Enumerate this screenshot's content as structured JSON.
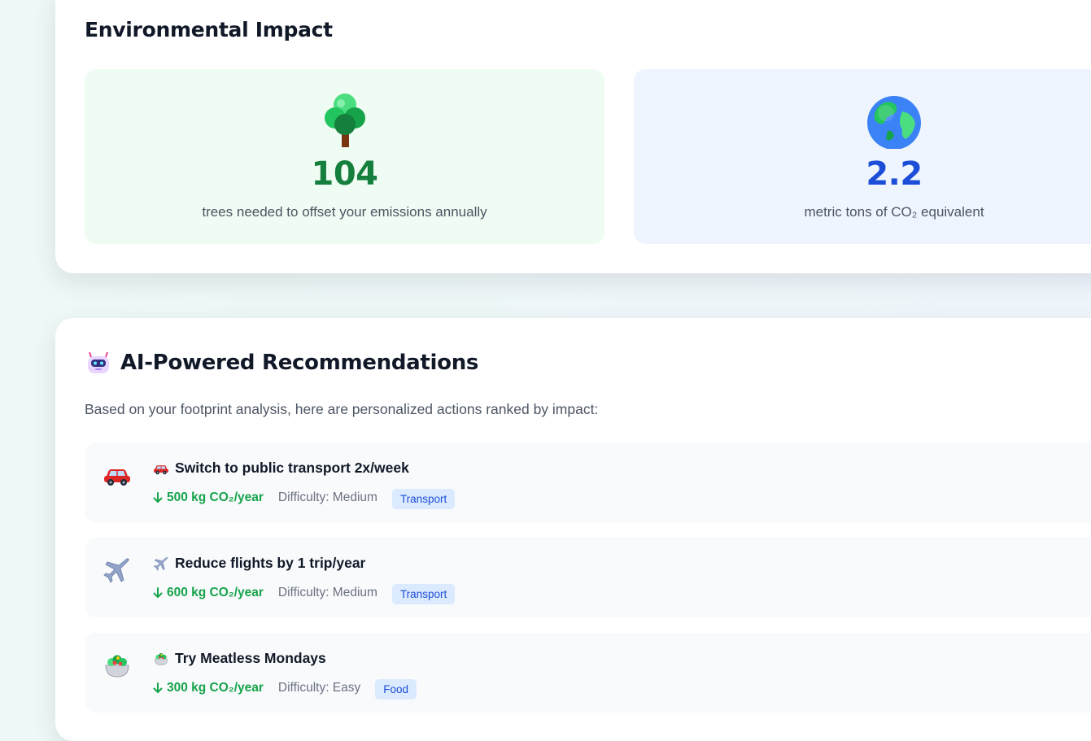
{
  "impact": {
    "title": "Environmental Impact",
    "trees": {
      "value": "104",
      "label": "trees needed to offset your emissions annually",
      "icon": "tree-icon"
    },
    "co2": {
      "value": "2.2",
      "label": "metric tons of CO₂ equivalent",
      "icon": "globe-icon"
    }
  },
  "recommendations": {
    "title": "AI-Powered Recommendations",
    "title_icon": "robot-icon",
    "intro": "Based on your footprint analysis, here are personalized actions ranked by impact:",
    "items": [
      {
        "title": "Switch to public transport 2x/week",
        "saving": "500 kg CO₂/year",
        "difficulty": "Difficulty: Medium",
        "category": "Transport",
        "icon": "car-icon"
      },
      {
        "title": "Reduce flights by 1 trip/year",
        "saving": "600 kg CO₂/year",
        "difficulty": "Difficulty: Medium",
        "category": "Transport",
        "icon": "airplane-icon"
      },
      {
        "title": "Try Meatless Mondays",
        "saving": "300 kg CO₂/year",
        "difficulty": "Difficulty: Easy",
        "category": "Food",
        "icon": "salad-icon"
      }
    ]
  },
  "colors": {
    "green": "#15803d",
    "blue": "#1d4ed8",
    "saving_green": "#16a34a",
    "tag_bg": "#dbeafe"
  }
}
